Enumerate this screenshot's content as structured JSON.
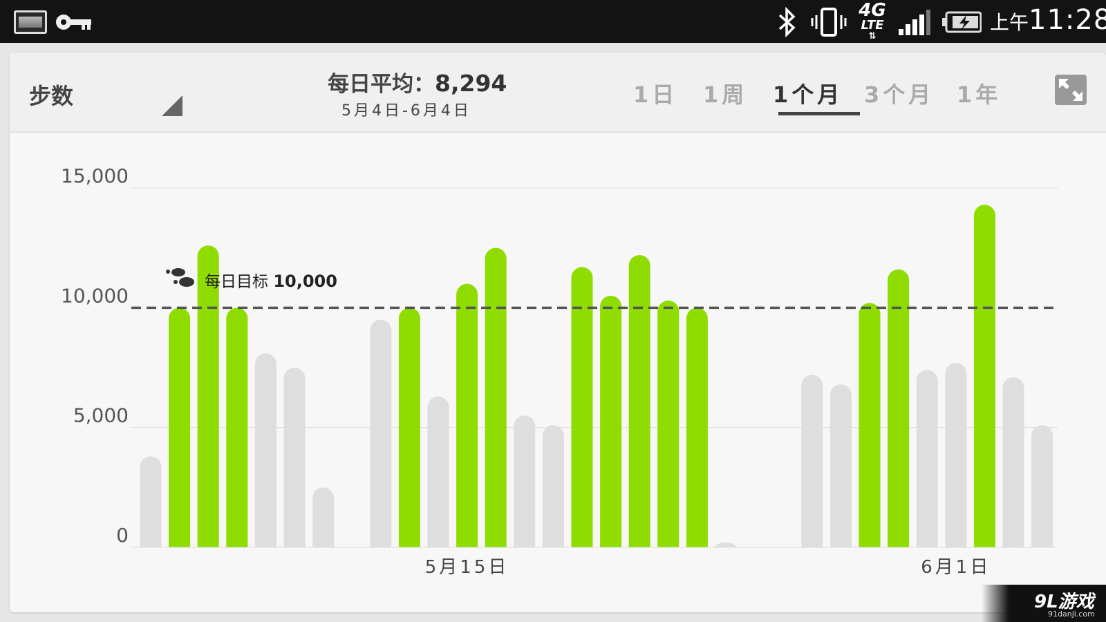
{
  "status_bar": {
    "ampm": "上午",
    "time": "11:28",
    "network_top": "4G",
    "network_bottom": "LTE",
    "network_arrows": "⇅",
    "icons": [
      "gallery-icon",
      "key-icon",
      "bluetooth-icon",
      "vibrate-icon",
      "lte-icon",
      "signal-icon",
      "battery-charging-icon"
    ]
  },
  "header": {
    "metric_label": "步数",
    "avg_label": "每日平均：",
    "avg_value": "8,294",
    "date_range": "5月4日-6月4日",
    "tabs": [
      {
        "label": "1日",
        "active": false
      },
      {
        "label": "1周",
        "active": false
      },
      {
        "label": "1个月",
        "active": true
      },
      {
        "label": "3个月",
        "active": false
      },
      {
        "label": "1年",
        "active": false
      }
    ]
  },
  "goal": {
    "label": "每日目标",
    "value": "10,000"
  },
  "colors": {
    "goal_met": "#8edc00",
    "goal_missed": "#dedede",
    "grid": "#dcdcdc",
    "goal_line": "#555555"
  },
  "chart_data": {
    "type": "bar",
    "ylim": [
      0,
      15000
    ],
    "yticks": [
      "0",
      "5,000",
      "10,000",
      "15,000"
    ],
    "goal": 10000,
    "x_labels": [
      {
        "text": "5月15日",
        "index": 11
      },
      {
        "text": "6月1日",
        "index": 28
      }
    ],
    "values": [
      3800,
      10000,
      12600,
      10000,
      8100,
      7500,
      2500,
      0,
      9500,
      10000,
      6300,
      11000,
      12500,
      5500,
      5100,
      11700,
      10500,
      12200,
      10300,
      10000,
      200,
      0,
      0,
      7200,
      6800,
      10200,
      11600,
      7400,
      7700,
      14300,
      7100,
      5100
    ]
  },
  "watermark": {
    "text": "9L游戏",
    "sub": "91danji.com"
  }
}
